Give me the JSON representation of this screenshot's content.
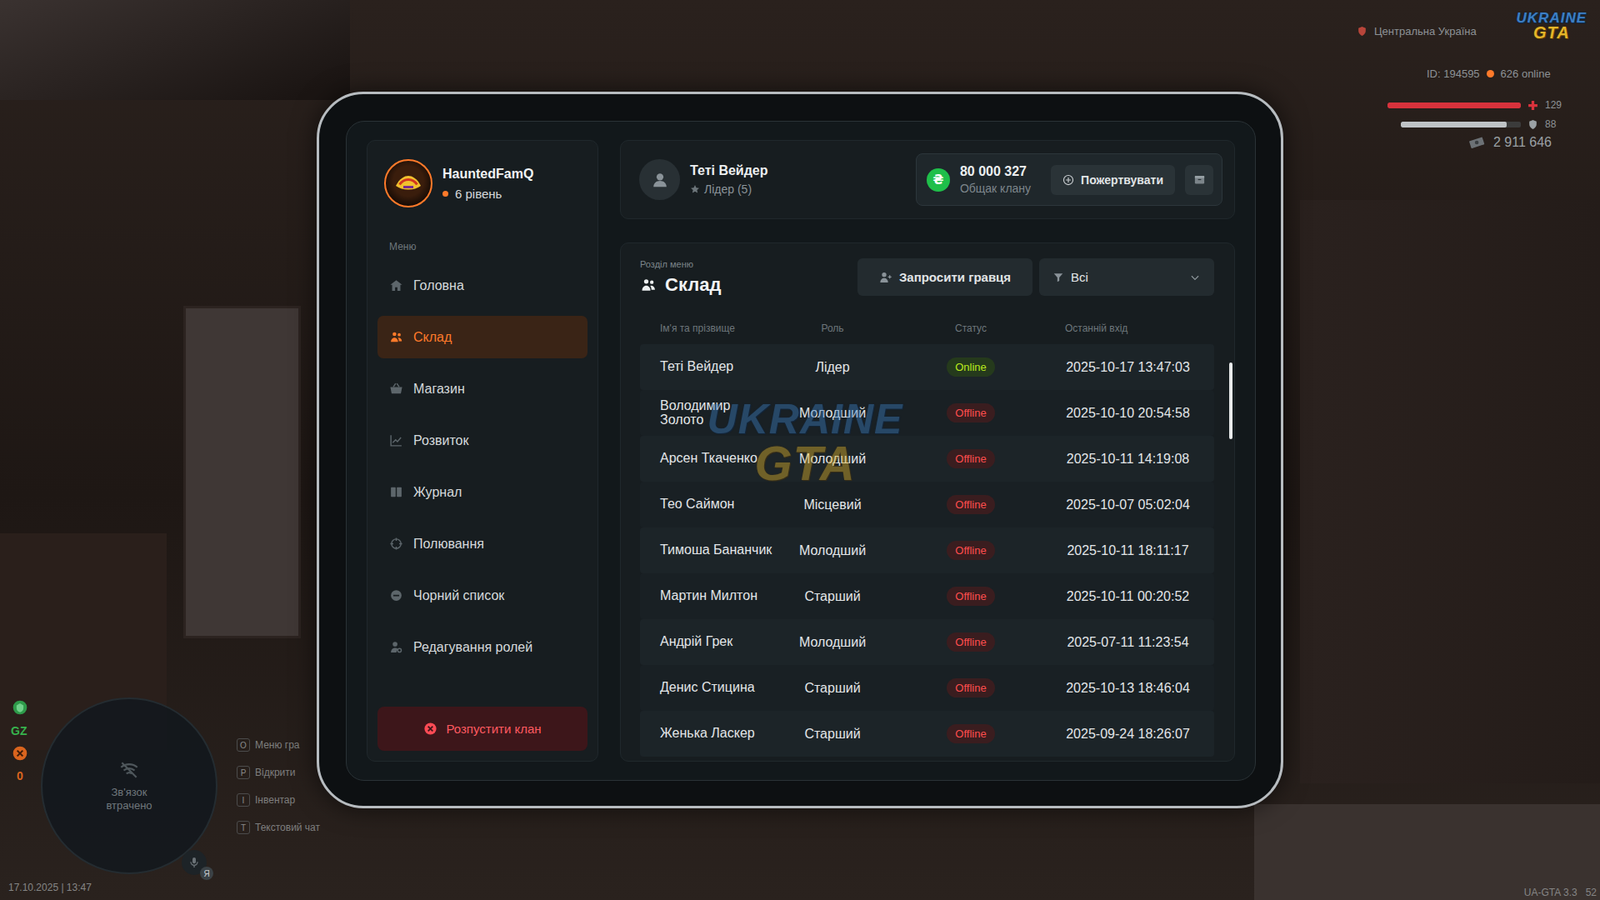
{
  "hud": {
    "logo": {
      "line1": "UKRAINE",
      "line2": "GTA"
    },
    "region": "Центральна Україна",
    "player_id": "ID: 194595",
    "online": "626 online",
    "health": {
      "value": "129",
      "level": 1
    },
    "armor": {
      "value": "88",
      "level": 0.88
    },
    "money": "2 911 646",
    "minimap_status": "Зв'язок втрачено",
    "zone_tag": "GZ",
    "wanted": "0",
    "keys": [
      {
        "key": "O",
        "label": "Меню гра"
      },
      {
        "key": "P",
        "label": "Відкрити"
      },
      {
        "key": "I",
        "label": "Інвентар"
      },
      {
        "key": "T",
        "label": "Текстовий чат"
      }
    ],
    "mic_badge": "Я",
    "datetime": "17.10.2025 | 13:47",
    "version": "UA-GTA 3.3",
    "fps": "52"
  },
  "watermark": {
    "line1": "UKRAINE",
    "line2": "GTA"
  },
  "tablet": {
    "clan": {
      "name": "HauntedFamQ",
      "level": "6 рівень"
    },
    "sidebar": {
      "heading": "Меню",
      "items": [
        {
          "label": "Головна",
          "selected": false
        },
        {
          "label": "Склад",
          "selected": true
        },
        {
          "label": "Магазин",
          "selected": false
        },
        {
          "label": "Розвиток",
          "selected": false
        },
        {
          "label": "Журнал",
          "selected": false
        },
        {
          "label": "Полювання",
          "selected": false
        },
        {
          "label": "Чорний список",
          "selected": false
        },
        {
          "label": "Редагування ролей",
          "selected": false
        }
      ],
      "dissolve_button": "Розпустити клан"
    },
    "header": {
      "player_name": "Теті Вейдер",
      "player_role": "Лідер (5)",
      "currency_symbol": "₴",
      "balance": "80 000 327",
      "balance_label": "Общак клану",
      "donate_button": "Пожертвувати"
    },
    "section": {
      "caption": "Розділ меню",
      "title": "Склад",
      "invite_button": "Запросити гравця",
      "filter": "Всі"
    },
    "table": {
      "columns": [
        "Ім'я та прізвище",
        "Роль",
        "Статус",
        "Останній вхід"
      ],
      "rows": [
        {
          "name": "Теті Вейдер",
          "role": "Лідер",
          "status": "Online",
          "online": true,
          "last_login": "2025-10-17 13:47:03"
        },
        {
          "name": "Володимир Золото",
          "role": "Молодший",
          "status": "Offline",
          "online": false,
          "last_login": "2025-10-10 20:54:58"
        },
        {
          "name": "Арсен Ткаченко",
          "role": "Молодший",
          "status": "Offline",
          "online": false,
          "last_login": "2025-10-11 14:19:08"
        },
        {
          "name": "Тео Саймон",
          "role": "Місцевий",
          "status": "Offline",
          "online": false,
          "last_login": "2025-10-07 05:02:04"
        },
        {
          "name": "Тимоша Бананчик",
          "role": "Молодший",
          "status": "Offline",
          "online": false,
          "last_login": "2025-10-11 18:11:17"
        },
        {
          "name": "Мартин Милтон",
          "role": "Старший",
          "status": "Offline",
          "online": false,
          "last_login": "2025-10-11 00:20:52"
        },
        {
          "name": "Андрій Грек",
          "role": "Молодший",
          "status": "Offline",
          "online": false,
          "last_login": "2025-07-11 11:23:54"
        },
        {
          "name": "Денис Стицина",
          "role": "Старший",
          "status": "Offline",
          "online": false,
          "last_login": "2025-10-13 18:46:04"
        },
        {
          "name": "Женька Ласкер",
          "role": "Старший",
          "status": "Offline",
          "online": false,
          "last_login": "2025-09-24 18:26:07"
        }
      ]
    }
  }
}
